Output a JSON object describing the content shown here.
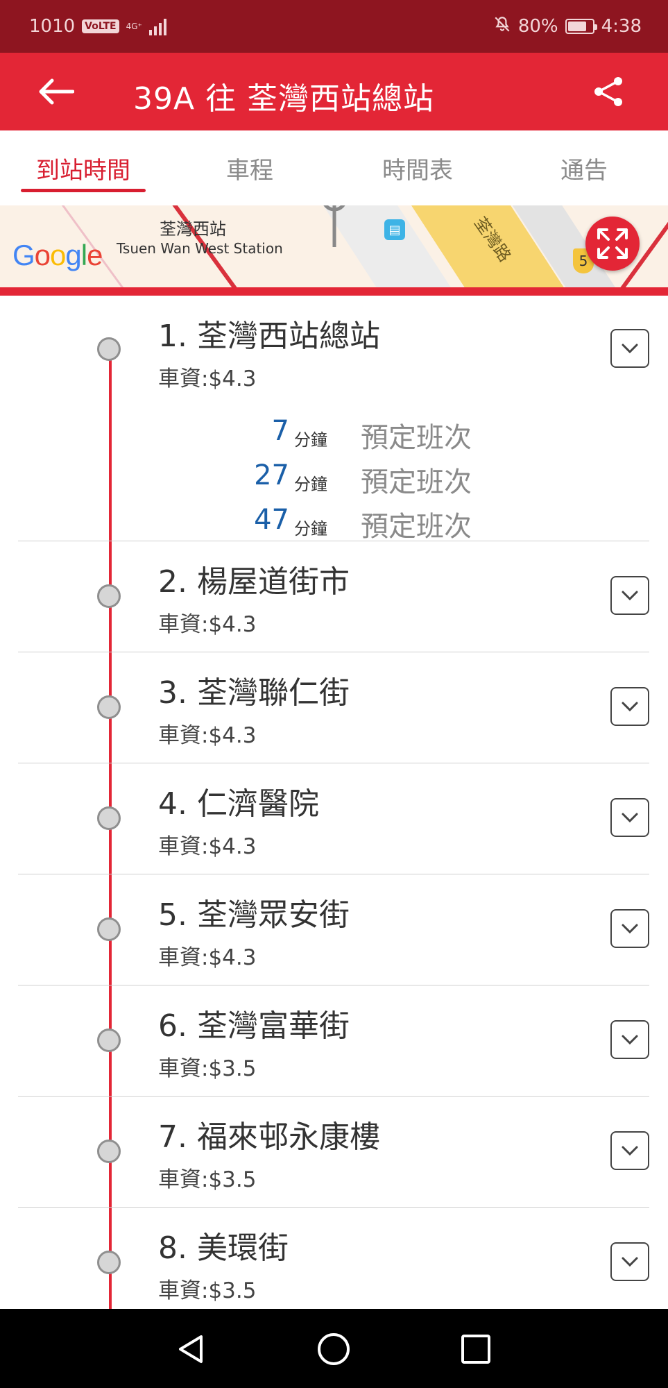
{
  "status_bar": {
    "left_text": "1010",
    "volte": "VoLTE",
    "network": "4G⁺",
    "battery_percent": "80%",
    "battery_level": 0.8,
    "time": "4:38"
  },
  "app_bar": {
    "title": "39A 往 荃灣西站總站"
  },
  "tabs": [
    {
      "label": "到站時間",
      "active": true
    },
    {
      "label": "車程",
      "active": false
    },
    {
      "label": "時間表",
      "active": false
    },
    {
      "label": "通告",
      "active": false
    }
  ],
  "map": {
    "station_name_zh": "荃灣西站",
    "station_name_en": "Tsuen Wan West Station",
    "road_label": "荃灣路",
    "route_shield": "5",
    "logo_text": "Google"
  },
  "stops": [
    {
      "name": "1. 荃灣西站總站",
      "fare": "車資:$4.3"
    },
    {
      "name": "2. 楊屋道街市",
      "fare": "車資:$4.3"
    },
    {
      "name": "3. 荃灣聯仁街",
      "fare": "車資:$4.3"
    },
    {
      "name": "4. 仁濟醫院",
      "fare": "車資:$4.3"
    },
    {
      "name": "5. 荃灣眾安街",
      "fare": "車資:$4.3"
    },
    {
      "name": "6. 荃灣富華街",
      "fare": "車資:$3.5"
    },
    {
      "name": "7. 福來邨永康樓",
      "fare": "車資:$3.5"
    },
    {
      "name": "8. 美環街",
      "fare": "車資:$3.5"
    }
  ],
  "etas": [
    {
      "minutes": "7",
      "unit": "分鐘",
      "type": "預定班次"
    },
    {
      "minutes": "27",
      "unit": "分鐘",
      "type": "預定班次"
    },
    {
      "minutes": "47",
      "unit": "分鐘",
      "type": "預定班次"
    }
  ],
  "colors": {
    "status_bar": "#8e1520",
    "brand_red": "#e32636",
    "eta_blue": "#1a5fa8"
  }
}
